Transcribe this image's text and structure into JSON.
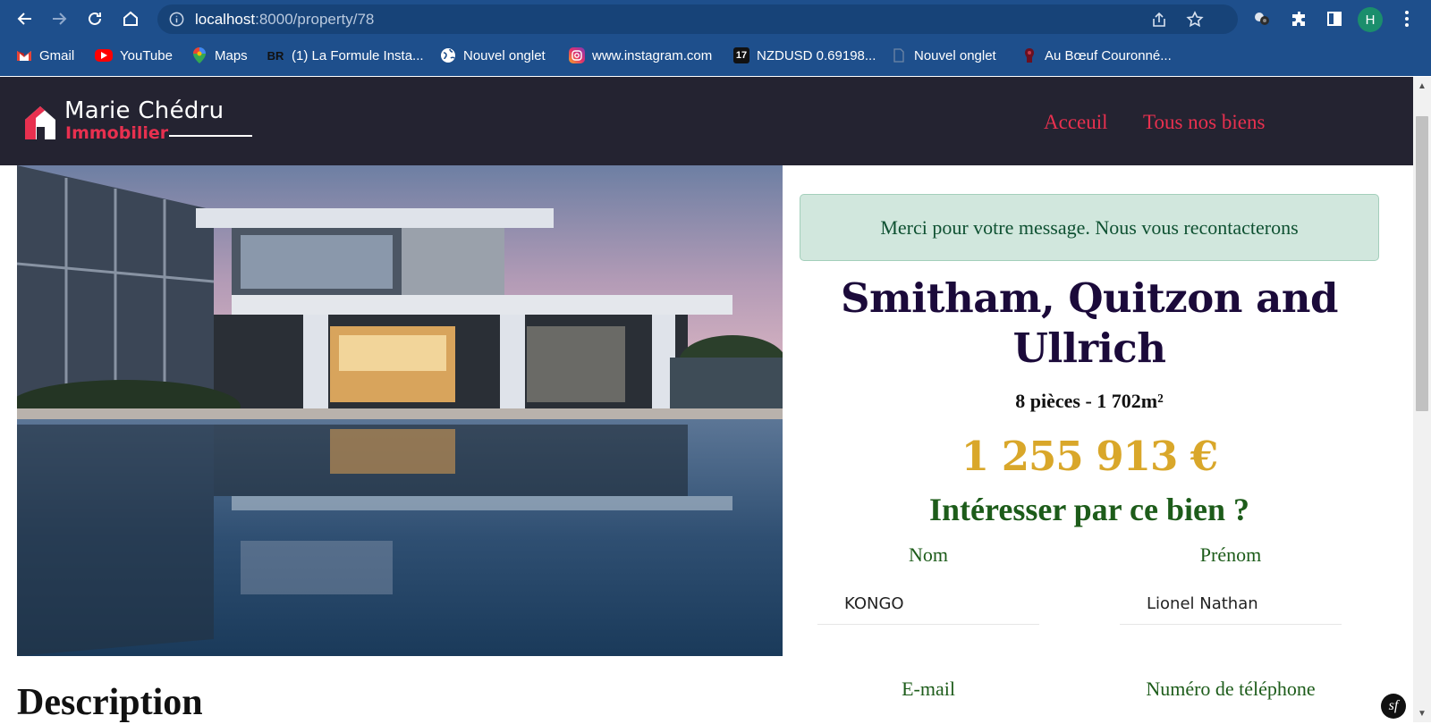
{
  "browser": {
    "url_host": "localhost",
    "url_path": ":8000/property/78",
    "profile_initial": "H",
    "bookmarks": [
      {
        "label": "Gmail",
        "icon": "gmail-icon"
      },
      {
        "label": "YouTube",
        "icon": "youtube-icon"
      },
      {
        "label": "Maps",
        "icon": "maps-icon"
      },
      {
        "label": "(1) La Formule Insta...",
        "icon": "br-icon",
        "icon_text": "BR"
      },
      {
        "label": "Nouvel onglet",
        "icon": "globe-icon"
      },
      {
        "label": "www.instagram.com",
        "icon": "instagram-icon"
      },
      {
        "label": "NZDUSD 0.69198...",
        "icon": "tradingview-icon",
        "icon_text": "17"
      },
      {
        "label": "Nouvel onglet",
        "icon": "page-icon"
      },
      {
        "label": "Au Bœuf Couronné...",
        "icon": "restaurant-icon"
      }
    ]
  },
  "site": {
    "logo_name": "Marie Chédru",
    "logo_sub": "Immobilier",
    "nav": [
      "Acceuil",
      "Tous nos biens"
    ],
    "colors": {
      "accent": "#e8304f",
      "header_bg": "#242331",
      "price": "#d9a72a",
      "green": "#1d5c1a"
    }
  },
  "property": {
    "alert": "Merci pour votre message. Nous vous recontacterons",
    "title": "Smitham, Quitzon and Ullrich",
    "meta": "8 pièces - 1 702m²",
    "price": "1 255 913 €",
    "interest": "Intéresser par ce bien ?",
    "description_title": "Description"
  },
  "form": {
    "nom_label": "Nom",
    "nom_value": "KONGO",
    "prenom_label": "Prénom",
    "prenom_value": "Lionel Nathan",
    "email_label": "E-mail",
    "phone_label": "Numéro de téléphone"
  },
  "debug_badge": "sf"
}
